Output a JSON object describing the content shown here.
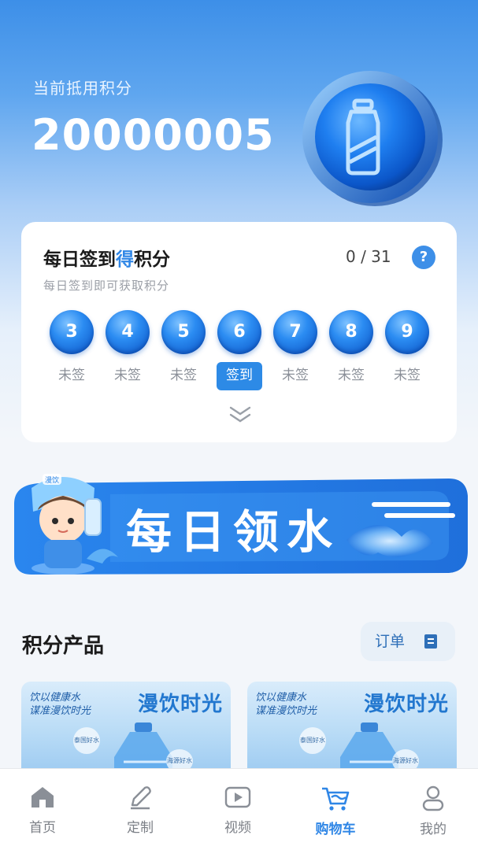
{
  "header": {
    "points_label": "当前抵用积分",
    "points_value": "20000005"
  },
  "signin": {
    "title_prefix": "每日签到",
    "title_highlight": "得",
    "title_suffix": "积分",
    "subtitle": "每日签到即可获取积分",
    "count": "0 / 31",
    "help": "?",
    "days": [
      {
        "day": "3",
        "status": "未签",
        "active": false
      },
      {
        "day": "4",
        "status": "未签",
        "active": false
      },
      {
        "day": "5",
        "status": "未签",
        "active": false
      },
      {
        "day": "6",
        "status": "签到",
        "active": true
      },
      {
        "day": "7",
        "status": "未签",
        "active": false
      },
      {
        "day": "8",
        "status": "未签",
        "active": false
      },
      {
        "day": "9",
        "status": "未签",
        "active": false
      }
    ]
  },
  "banner": {
    "text": "每日领水",
    "mascot_tag": "漫饮"
  },
  "products_section": {
    "title": "积分产品",
    "order_button": "订单"
  },
  "products": [
    {
      "title": "漫饮时光",
      "slogan_line1": "饮以健康水",
      "slogan_line2": "谋准漫饮时光",
      "tag1": "泰国好水",
      "tag2": "海源好水"
    },
    {
      "title": "漫饮时光",
      "slogan_line1": "饮以健康水",
      "slogan_line2": "谋准漫饮时光",
      "tag1": "泰国好水",
      "tag2": "海源好水"
    }
  ],
  "tabbar": [
    {
      "label": "首页",
      "icon": "home-icon",
      "active": false
    },
    {
      "label": "定制",
      "icon": "pen-icon",
      "active": false
    },
    {
      "label": "视频",
      "icon": "video-icon",
      "active": false
    },
    {
      "label": "购物车",
      "icon": "cart-icon",
      "active": true
    },
    {
      "label": "我的",
      "icon": "user-icon",
      "active": false
    }
  ],
  "colors": {
    "accent": "#2f86e6",
    "header_top": "#3d8fe8",
    "page_bg": "#f3f6fa"
  }
}
